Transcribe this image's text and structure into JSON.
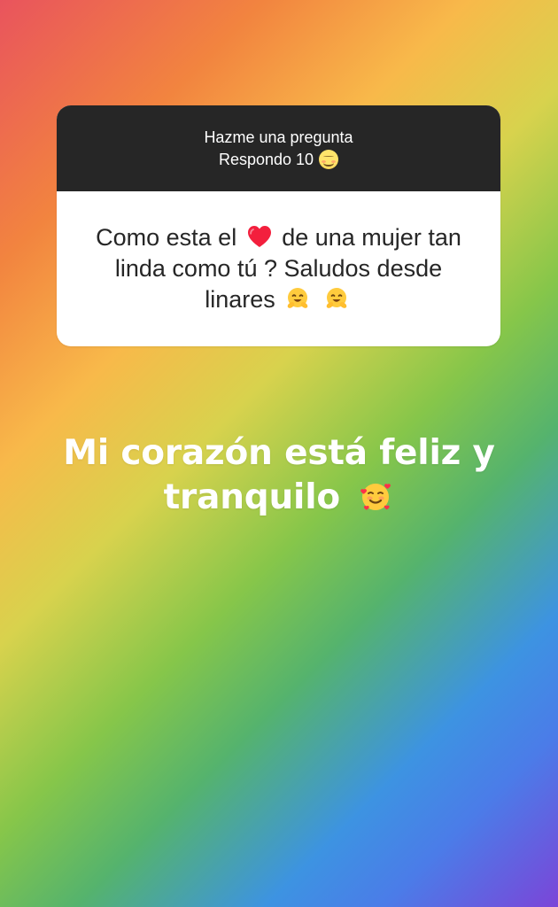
{
  "colors": {
    "background_gradient": [
      "#e9545d",
      "#f2843f",
      "#f8b94a",
      "#d8d24d",
      "#86c64a",
      "#55b36d",
      "#3d93e2",
      "#4b7ce8",
      "#7b45d8"
    ],
    "question_header_bg": "#262626",
    "question_body_bg": "#ffffff",
    "question_text": "#262626",
    "answer_text": "#ffffff"
  },
  "question_card": {
    "header": {
      "title": "Hazme una pregunta",
      "subtitle": "Respondo 10",
      "subtitle_emoji": "smiling-face-emoji"
    },
    "body": {
      "part_1": "Como esta el ",
      "heart_emoji": "red-heart-emoji",
      "part_2": " de una mujer tan linda como tú ? Saludos desde linares",
      "trailing_emojis": [
        "hugging-face-emoji",
        "hugging-face-emoji"
      ]
    }
  },
  "answer": {
    "line_1": "Mi corazón está feliz y",
    "line_2": "tranquilo",
    "emoji": "smiling-face-with-hearts-emoji"
  }
}
